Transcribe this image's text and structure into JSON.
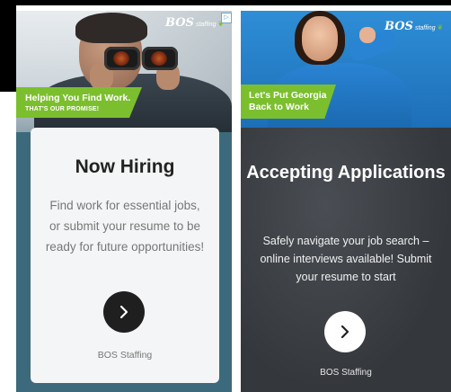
{
  "ad_left": {
    "banner_line1": "Helping You Find Work.",
    "banner_line2": "THAT'S OUR PROMISE!",
    "logo_text": "BOS",
    "logo_sub": "staffing",
    "adchoices_glyph": "▷",
    "title": "Now Hiring",
    "body": "Find work for essential jobs, or submit your resume to be ready for future opportunities!",
    "cta_icon": "chevron-right-icon",
    "brand": "BOS Staffing"
  },
  "ad_right": {
    "banner_line1": "Let's Put Georgia",
    "banner_line2": "Back to Work",
    "logo_text": "BOS",
    "logo_sub": "staffing",
    "title": "Accepting Applications",
    "body": "Safely navigate your job search – online interviews available! Submit your resume to start",
    "cta_icon": "chevron-right-icon",
    "brand": "BOS Staffing"
  },
  "colors": {
    "brand_green": "#7bbf2e",
    "brand_blue": "#1e7fc0",
    "left_bg": "#3c6a7c",
    "right_bg": "#3a3d42"
  }
}
